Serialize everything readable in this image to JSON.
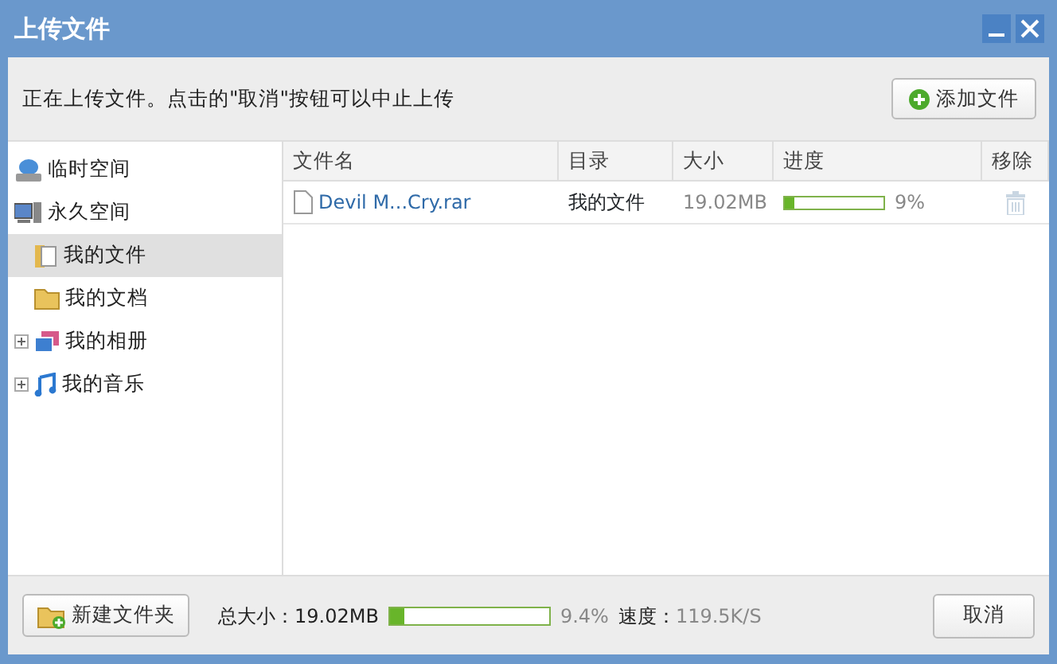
{
  "window": {
    "title": "上传文件"
  },
  "notice": "正在上传文件。点击的\"取消\"按钮可以中止上传",
  "add_button": "添加文件",
  "sidebar": {
    "items": [
      {
        "label": "临时空间",
        "selected": false
      },
      {
        "label": "永久空间",
        "selected": false,
        "children": [
          {
            "label": "我的文件",
            "selected": true,
            "collapsible": false
          },
          {
            "label": "我的文档",
            "selected": false,
            "collapsible": false
          },
          {
            "label": "我的相册",
            "selected": false,
            "collapsible": true
          },
          {
            "label": "我的音乐",
            "selected": false,
            "collapsible": true
          }
        ]
      }
    ]
  },
  "table": {
    "columns": [
      "文件名",
      "目录",
      "大小",
      "进度",
      "移除"
    ],
    "rows": [
      {
        "name": "Devil M...Cry.rar",
        "folder": "我的文件",
        "size": "19.02MB",
        "level": 0.09,
        "percent": "9%"
      }
    ]
  },
  "footer": {
    "new_folder_button": "新建文件夹",
    "total_label": "总大小：",
    "total": "19.02MB",
    "level": 0.094,
    "percent": "9.4%",
    "speed_label": "速度：",
    "speed": "119.5K/S",
    "cancel_button": "取消"
  }
}
